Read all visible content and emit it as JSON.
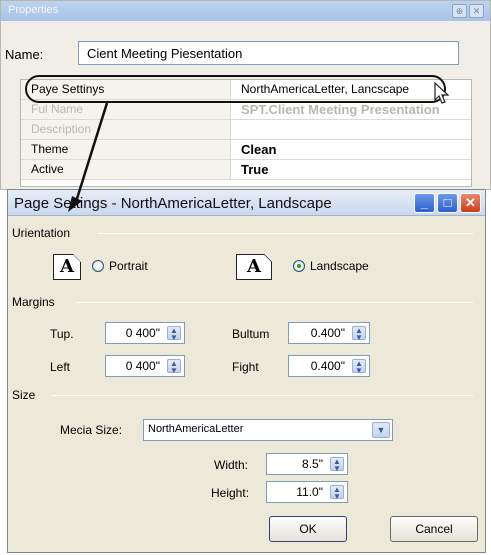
{
  "properties": {
    "title": "Properties",
    "pin_glyph": "⊕",
    "close_glyph": "✕",
    "name_label": "Name:",
    "name_value": "Cient Meeting Piesentation",
    "rows": [
      {
        "key": "Paye Settinys",
        "value": "NorthAmericaLetter, Lancscape"
      },
      {
        "key": "Ful Name",
        "value": "SPT.Client Meeting Presentation"
      },
      {
        "key": "Description",
        "value": ""
      },
      {
        "key": "Theme",
        "value": "Clean"
      },
      {
        "key": "Active",
        "value": "True"
      }
    ]
  },
  "dialog": {
    "title": "Page Settings - NorthAmericaLetter, Landscape",
    "minimize_glyph": "_",
    "maximize_glyph": "□",
    "close_glyph": "✕",
    "orientation": {
      "label": "Urientation",
      "icon_letter": "A",
      "portrait_label": "Portrait",
      "landscape_label": "Landscape",
      "selected": "landscape"
    },
    "margins": {
      "label": "Margins",
      "top_label": "Tup.",
      "top_value": "0 400\"",
      "bottom_label": "Bultum",
      "bottom_value": "0.400\"",
      "left_label": "Left",
      "left_value": "0 400\"",
      "right_label": "Fight",
      "right_value": "0.400\""
    },
    "size": {
      "label": "Size",
      "media_label": "Mecia Size:",
      "media_value": "NorthAmericaLetter",
      "width_label": "Width:",
      "width_value": "8.5\"",
      "height_label": "Height:",
      "height_value": "11.0\""
    },
    "ok_label": "OK",
    "cancel_label": "Cancel"
  },
  "icons": [
    "pin-icon",
    "close-icon",
    "minimize-icon",
    "maximize-icon",
    "portrait-page-icon",
    "landscape-page-icon",
    "spin-arrows-icon",
    "chevron-down-icon",
    "mouse-pointer-icon",
    "callout-arrow"
  ],
  "colors": {
    "title_gradient": "#bdd3ef",
    "dialog_bg": "#ece9d8",
    "close_red": "#cf3a17",
    "radio_on": "#21a121"
  }
}
